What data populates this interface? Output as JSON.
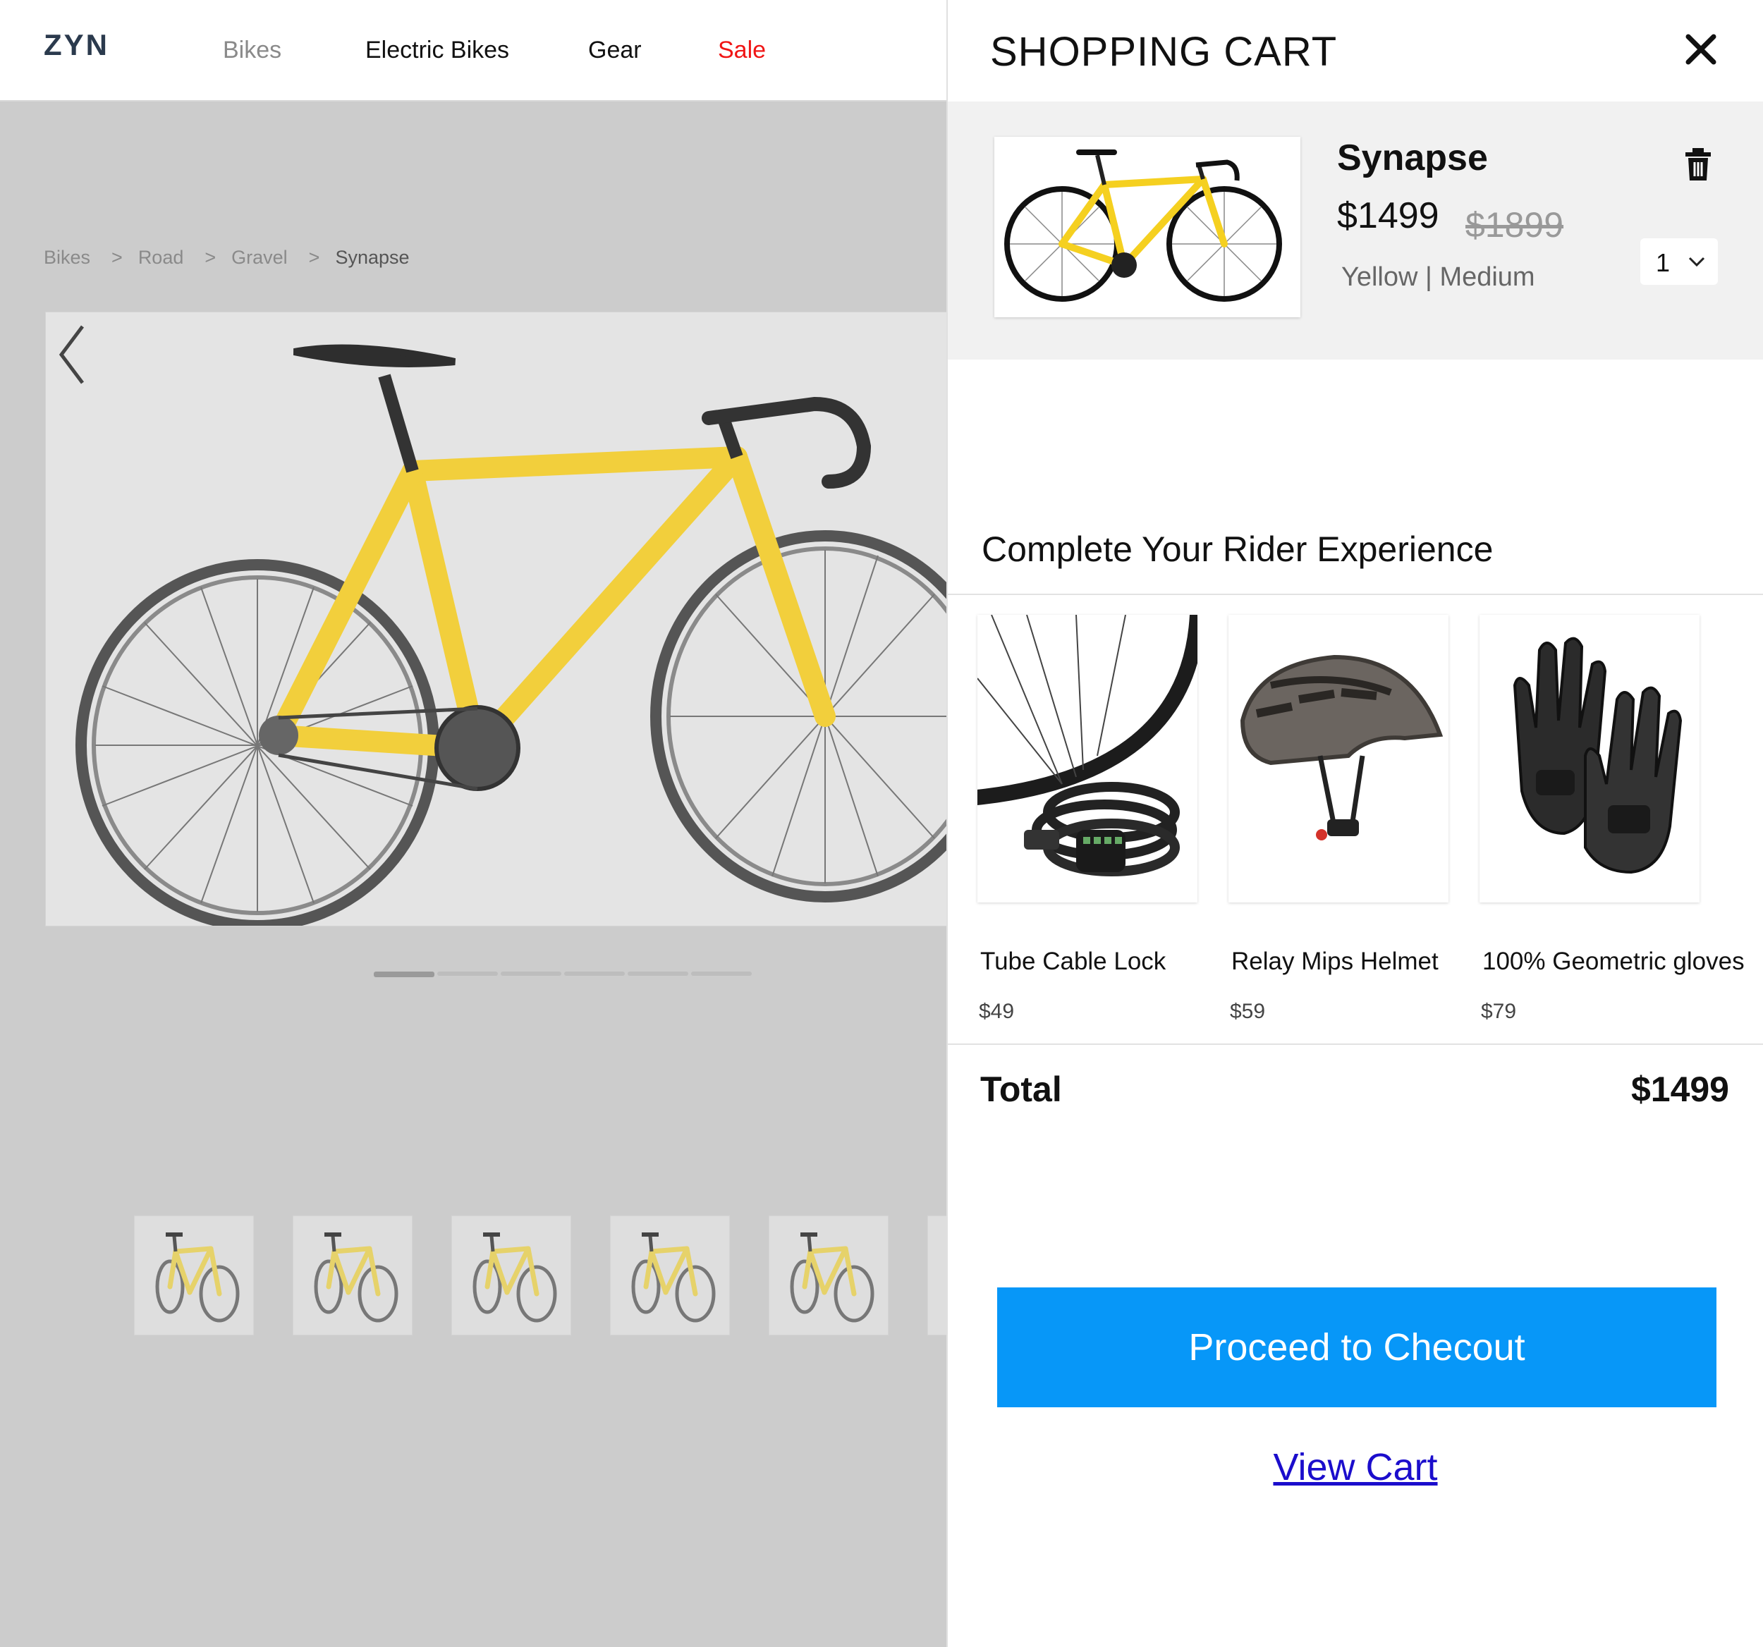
{
  "nav": {
    "logo": "ZYN",
    "links": [
      {
        "label": "Bikes",
        "color": "#8a8a8a"
      },
      {
        "label": "Electric Bikes",
        "color": "#111111"
      },
      {
        "label": "Gear",
        "color": "#111111"
      },
      {
        "label": "Sale",
        "color": "#f01515"
      }
    ]
  },
  "breadcrumb": {
    "items": [
      "Bikes",
      "Road",
      "Gravel",
      "Synapse"
    ],
    "separator": ">"
  },
  "gallery": {
    "main_image": "yellow-road-bike-image",
    "slide_count": 6,
    "active_slide": 1,
    "thumbnails": [
      "bike-thumbnail",
      "bike-thumbnail",
      "bike-thumbnail",
      "bike-thumbnail",
      "bike-thumbnail",
      "bike-thumbnail"
    ]
  },
  "cart": {
    "title": "SHOPPING CART",
    "item": {
      "name": "Synapse",
      "price": "$1499",
      "old_price": "$1899",
      "variant": "Yellow | Medium",
      "quantity": "1"
    },
    "upsell": {
      "title": "Complete Your Rider Experience",
      "products": [
        {
          "name": "Tube Cable Lock",
          "price": "$49",
          "image": "cable-lock-image"
        },
        {
          "name": "Relay Mips Helmet",
          "price": "$59",
          "image": "helmet-image"
        },
        {
          "name": "100% Geometric gloves",
          "price": "$79",
          "image": "gloves-image"
        }
      ]
    },
    "total_label": "Total",
    "total_value": "$1499",
    "checkout_label": "Proceed to Checout",
    "view_cart_label": "View Cart"
  },
  "colors": {
    "accent": "#0797f8",
    "sale": "#f01515",
    "link": "#1b0dcc",
    "bike_yellow": "#f2cf3c"
  }
}
